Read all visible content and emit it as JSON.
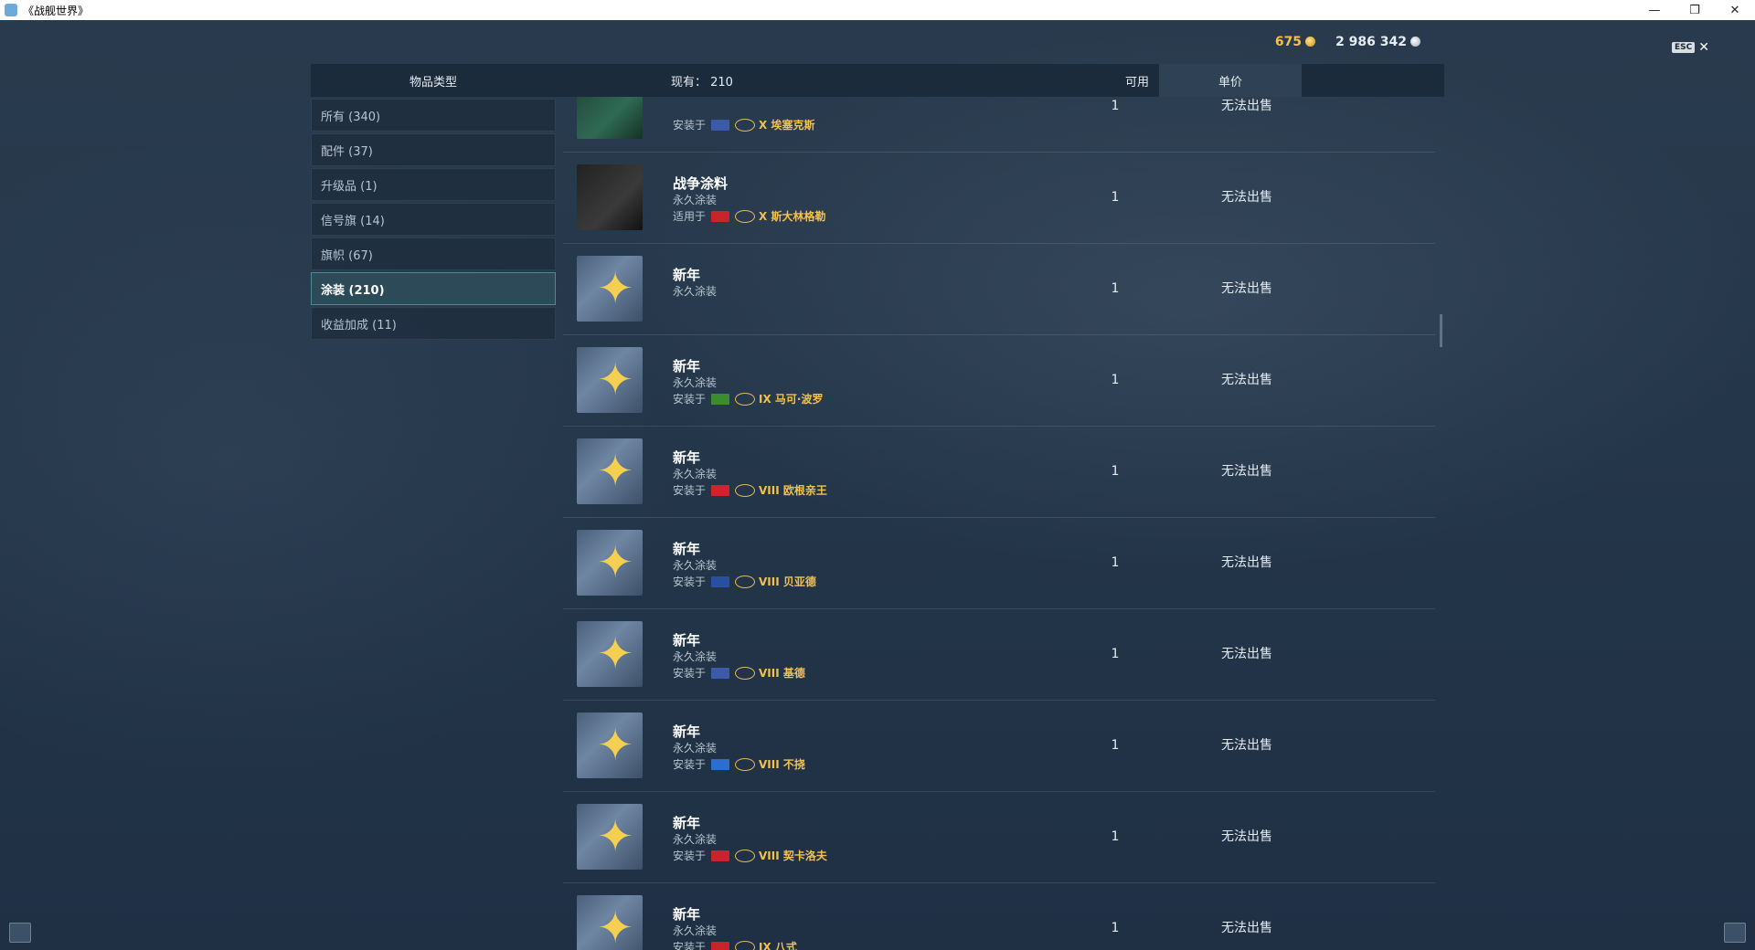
{
  "window": {
    "title": "《战舰世界》"
  },
  "currency": {
    "gold": "675",
    "credits": "2 986 342"
  },
  "esc": {
    "key": "ESC"
  },
  "header": {
    "type_label": "物品类型",
    "count_label": "现有：  210",
    "available_label": "可用",
    "price_label": "单价"
  },
  "categories": [
    {
      "label": "所有 (340)"
    },
    {
      "label": "配件 (37)"
    },
    {
      "label": "升级品 (1)"
    },
    {
      "label": "信号旗 (14)"
    },
    {
      "label": "旗帜 (67)"
    },
    {
      "label": "涂装 (210)",
      "active": true
    },
    {
      "label": "收益加成 (11)"
    }
  ],
  "items": [
    {
      "name": "",
      "sub": "",
      "inst_label": "安装于",
      "flag": "#3b5aa8",
      "ship": "X 埃塞克斯",
      "available": "1",
      "price": "无法出售",
      "thumb": "green"
    },
    {
      "name": "战争涂料",
      "sub": "永久涂装",
      "inst_label": "适用于",
      "flag": "#c8252a",
      "ship": "X 斯大林格勒",
      "available": "1",
      "price": "无法出售",
      "thumb": "dark"
    },
    {
      "name": "新年",
      "sub": "永久涂装",
      "inst_label": "",
      "flag": "",
      "ship": "",
      "available": "1",
      "price": "无法出售",
      "thumb": "star"
    },
    {
      "name": "新年",
      "sub": "永久涂装",
      "inst_label": "安装于",
      "flag": "#3a8c2e",
      "ship": "IX 马可·波罗",
      "available": "1",
      "price": "无法出售",
      "thumb": "star"
    },
    {
      "name": "新年",
      "sub": "永久涂装",
      "inst_label": "安装于",
      "flag": "#d0242a",
      "ship": "VIII 欧根亲王",
      "available": "1",
      "price": "无法出售",
      "thumb": "star"
    },
    {
      "name": "新年",
      "sub": "永久涂装",
      "inst_label": "安装于",
      "flag": "#2b4fa0",
      "ship": "VIII 贝亚德",
      "available": "1",
      "price": "无法出售",
      "thumb": "star"
    },
    {
      "name": "新年",
      "sub": "永久涂装",
      "inst_label": "安装于",
      "flag": "#3b5aa8",
      "ship": "VIII 基德",
      "available": "1",
      "price": "无法出售",
      "thumb": "star"
    },
    {
      "name": "新年",
      "sub": "永久涂装",
      "inst_label": "安装于",
      "flag": "#2a6fd0",
      "ship": "VIII 不挠",
      "available": "1",
      "price": "无法出售",
      "thumb": "star"
    },
    {
      "name": "新年",
      "sub": "永久涂装",
      "inst_label": "安装于",
      "flag": "#c8252a",
      "ship": "VIII 契卡洛夫",
      "available": "1",
      "price": "无法出售",
      "thumb": "star"
    },
    {
      "name": "新年",
      "sub": "永久涂装",
      "inst_label": "安装于",
      "flag": "#c8252a",
      "ship": "IX 八式",
      "available": "1",
      "price": "无法出售",
      "thumb": "star"
    }
  ]
}
